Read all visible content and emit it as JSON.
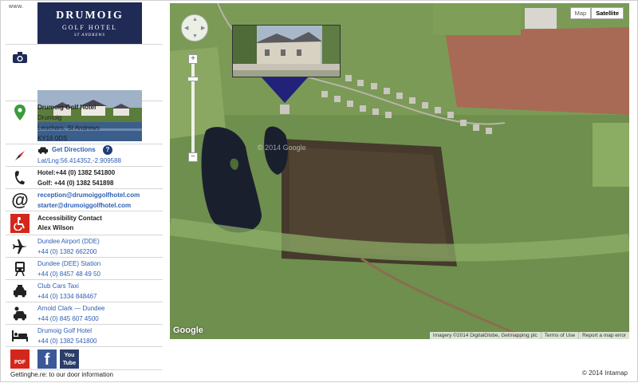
{
  "header": {
    "www": "www.",
    "logo_name": "DRUMOIG",
    "logo_sub": "GOLF HOTEL",
    "logo_place": "ST ANDREWS"
  },
  "address": {
    "name": "Drumoig Golf Hotel",
    "line1": "Drumoig",
    "line2": "Leuchars, St Andrews",
    "postcode": "KY16 0DS"
  },
  "directions": {
    "label": "Get Directions",
    "help": "?",
    "latlng": "Lat/Lng:56.414352,-2.909588"
  },
  "phones": {
    "hotel": "Hotel:+44 (0) 1382 541800",
    "golf": "Golf:  +44 (0) 1382 541898"
  },
  "emails": {
    "reception": "reception@drumoiggolfhotel.com",
    "starter": "starter@drumoiggolfhotel.com"
  },
  "accessibility": {
    "label": "Accessibility Contact",
    "name": "Alex Wilson"
  },
  "transport": [
    {
      "name": "Dundee Airport (DDE)",
      "phone": "+44 (0) 1382 662200"
    },
    {
      "name": "Dundee (DEE) Station",
      "phone": "+44 (0) 8457 48 49 50"
    },
    {
      "name": "Club Cars Taxi",
      "phone": "+44 (0) 1334 848467"
    },
    {
      "name": "Arnold Clark — Dundee",
      "phone": "+44 (0) 845 607 4500"
    },
    {
      "name": "Drumoig Golf Hotel",
      "phone": "+44 (0) 1382 541800"
    }
  ],
  "social": {
    "pdf_label": "PDF",
    "facebook_label": "f",
    "youtube_label": "You Tube",
    "footer": "Gettinghe.re: to our door information"
  },
  "map": {
    "type_map": "Map",
    "type_satellite": "Satellite",
    "google": "Google",
    "imagery": "Imagery ©2014 DigitalGlobe, Getmapping plc",
    "terms": "Terms of Use",
    "report": "Report a map error",
    "watermark": "© 2014 Google",
    "copyright": "© 2014 Intamap",
    "colors": {
      "satellite_green": "#6f8f4e",
      "pin": "#22227a",
      "link": "#2d5fb3"
    }
  }
}
